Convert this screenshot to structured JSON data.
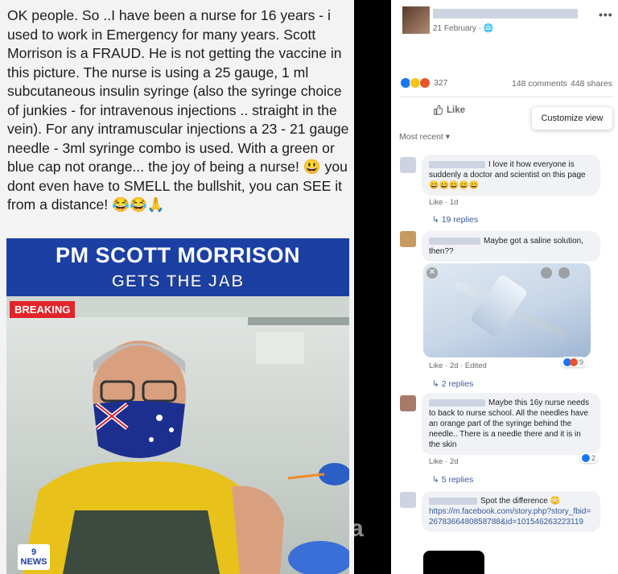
{
  "left_post": {
    "text": "OK people. So ..I have been a nurse for 16 years - i used to work in Emergency for many years. Scott Morrison is a FRAUD. He is not getting the vaccine in this picture. The nurse is using a 25 gauge, 1 ml subcutaneous insulin syringe (also the syringe choice of junkies - for intravenous injections .. straight in the vein). For any intramuscular injections a 23 - 21 gauge needle - 3ml syringe combo is used. With a green or blue cap not orange... the joy of being a nurse! 😃 you dont even have to SMELL the bullshit, you can SEE it from a distance! 😂😂🙏",
    "banner_title": "PM SCOTT MORRISON",
    "banner_subtitle": "GETS THE JAB",
    "breaking_label": "BREAKING",
    "logo_text": "9 NEWS"
  },
  "fb_post": {
    "date": "21 February · 🌐",
    "more_label": "•••",
    "reaction_count": "327",
    "comments_count": "148 comments",
    "shares_count": "448 shares",
    "like_label": "Like",
    "tooltip": "Customize view",
    "sort_label": "Most recent ▾"
  },
  "comments": [
    {
      "text": "I love it how everyone is suddenly a doctor and scientist on this page 😄😄😄😄😄",
      "meta": "Like · 1d",
      "replies": "19 replies"
    },
    {
      "text": "Maybe got a saline solution, then??",
      "meta": "Like · 2d · Edited",
      "replies": "2 replies",
      "reaction_count": "9"
    },
    {
      "text": "Maybe this 16y nurse needs to back to nurse school. All the needles have an orange part of the syringe behind the needle.. There is a needle there and it is in the skin",
      "meta": "Like · 2d",
      "replies": "5 replies",
      "reaction_count": "2"
    },
    {
      "text": "Spot the difference 😳",
      "link": "https://m.facebook.com/story.php?story_fbid=2678366480858788&id=101546263223119"
    }
  ],
  "watermark": "a",
  "colors": {
    "banner_blue": "#1b3fa3",
    "breaking_red": "#e1242a",
    "fb_link": "#385898"
  }
}
